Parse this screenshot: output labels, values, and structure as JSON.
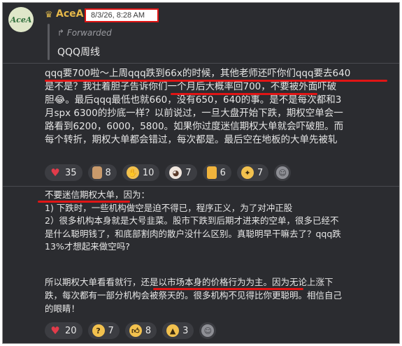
{
  "message1": {
    "avatar_text": "AceA",
    "author": "AceA",
    "timestamp": "8/3/26, 8:28 AM",
    "forwarded_label": "Forwarded",
    "forwarded_text": "QQQ周线",
    "body_lines": [
      "qqq要700啦～上周qqq跌到66x的时候，其他老师还吓你们qqq要去640",
      "是不是？我壮着胆子告诉你们一个月后大概率回700，不要被外面吓破",
      "胆😂。最后qqq最低也就660，没有650，640的事。是不是每次都和3",
      "月spx 6300的抄底一样？以前说过，一旦大盘开始下跌，期权空单会一",
      "路看到6200，6000，5800。如果你过度迷信期权大单就会吓破胆。而",
      "每个转折，期权大单都会错过，每次都是。最后空在地板的大单先被轧"
    ],
    "reactions": [
      {
        "icon": "heart-icon",
        "count": "35"
      },
      {
        "icon": "bubble-tea-icon",
        "count": "8"
      },
      {
        "icon": "handshake-icon",
        "count": "10"
      },
      {
        "icon": "cow-icon",
        "count": "7"
      },
      {
        "icon": "beer-icon",
        "count": "6"
      },
      {
        "icon": "clap-icon",
        "count": "7"
      }
    ]
  },
  "message2": {
    "body_lines": [
      "不要迷信期权大单，因为：",
      "1)   下跌时，一些机构做空是迫不得已，程序正义，为了对冲正股",
      "2）很多机构本身就是大号韭菜。股市下跌到后期才进来的空单，很多已经不",
      "是什么聪明钱了，和底部割肉的散户没什么区别。真聪明早干嘛去了？qqq跌",
      "13%才想起来做空吗?"
    ],
    "body_lines_b": [
      "所以期权大单看看就行，还是以市场本身的价格行为为主。因为无论上涨下",
      "跌，每次都有一部分机构会被祭天的。很多机构不见得比你更聪明。相信自己",
      "的眼睛！"
    ],
    "reactions": [
      {
        "icon": "heart-icon",
        "count": "20"
      },
      {
        "icon": "thinking-icon",
        "count": "7"
      },
      {
        "icon": "thumbs-up-icon",
        "count": "8"
      },
      {
        "icon": "pray-icon",
        "count": "3"
      }
    ]
  },
  "colors": {
    "background": "#2b2c30",
    "highlight": "#e01515",
    "author": "#e6b84a",
    "pill": "#3c3d42"
  }
}
